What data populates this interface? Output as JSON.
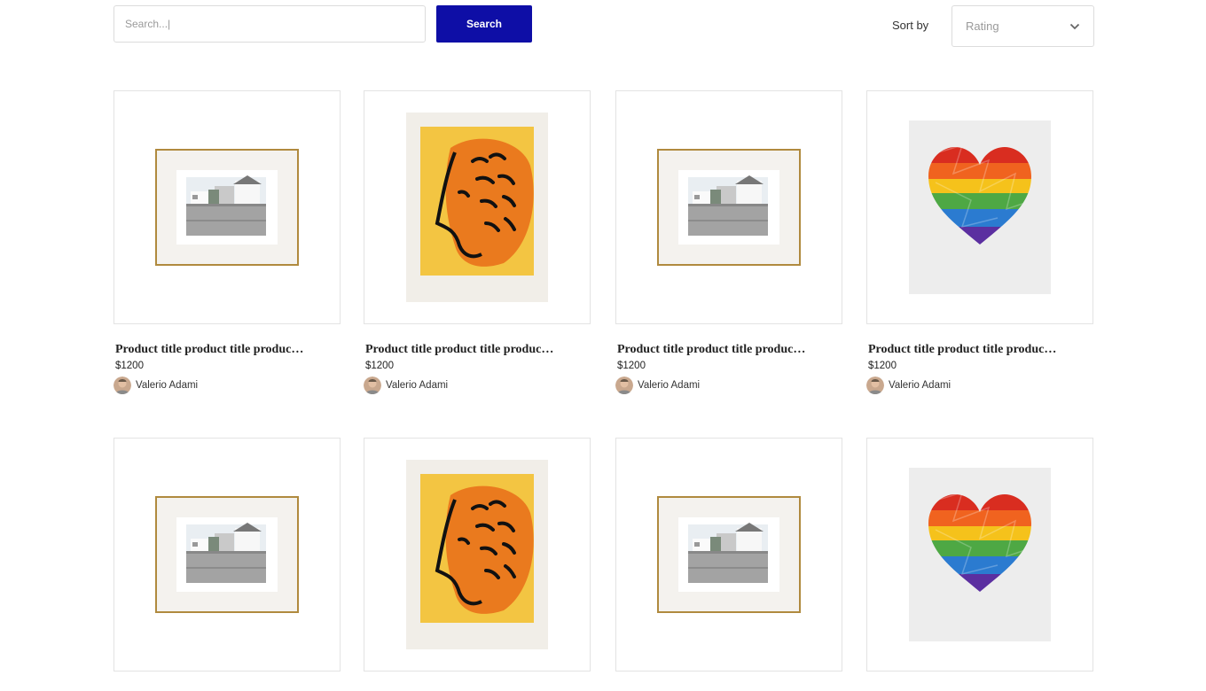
{
  "search": {
    "placeholder": "Search...|",
    "button_label": "Search"
  },
  "sort": {
    "label": "Sort by",
    "value": "Rating"
  },
  "products": [
    {
      "artwork": "framed-photo-houses",
      "title": "Product title product title produc…",
      "price": "$1200",
      "artist": "Valerio Adami"
    },
    {
      "artwork": "orange-lion-print",
      "title": "Product title product title produc…",
      "price": "$1200",
      "artist": "Valerio Adami"
    },
    {
      "artwork": "framed-photo-houses",
      "title": "Product title product title produc…",
      "price": "$1200",
      "artist": "Valerio Adami"
    },
    {
      "artwork": "rainbow-heart",
      "title": "Product title product title produc…",
      "price": "$1200",
      "artist": "Valerio Adami"
    },
    {
      "artwork": "framed-photo-houses",
      "title": "",
      "price": "",
      "artist": ""
    },
    {
      "artwork": "orange-lion-print",
      "title": "",
      "price": "",
      "artist": ""
    },
    {
      "artwork": "framed-photo-houses",
      "title": "",
      "price": "",
      "artist": ""
    },
    {
      "artwork": "rainbow-heart",
      "title": "",
      "price": "",
      "artist": ""
    }
  ],
  "colors": {
    "accent": "#0e0ea6",
    "border": "#e3e3e3"
  }
}
